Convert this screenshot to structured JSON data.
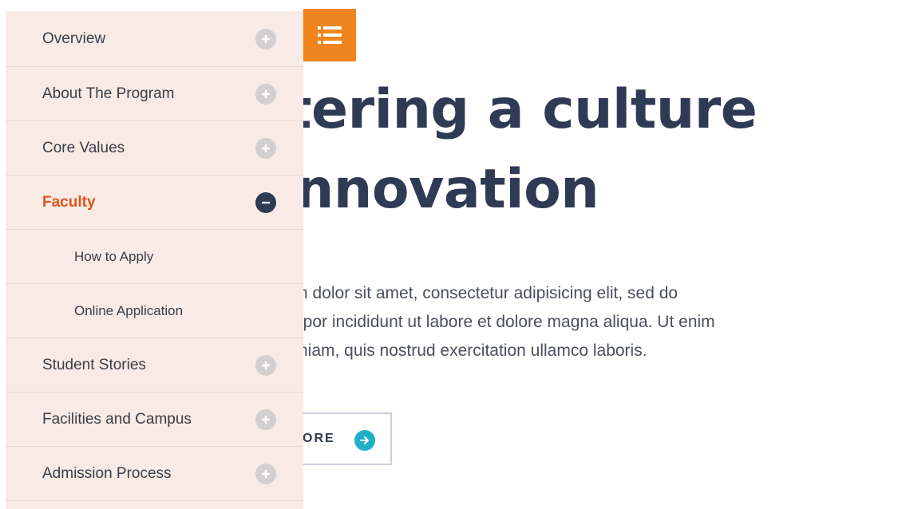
{
  "menu_toggle": {
    "icon": "list-icon",
    "color": "#f0851f"
  },
  "hero": {
    "title_line1": "tering a culture",
    "title_line2": "nnovation",
    "text_line1": "n dolor sit amet, consectetur adipisicing elit, sed do",
    "text_line2": "npor incididunt ut labore et dolore magna aliqua. Ut enim",
    "text_line3": "niam, quis nostrud exercitation ullamco laboris.",
    "button_label": "ORE",
    "button_icon": "arrow-right-icon"
  },
  "sidebar": {
    "items": [
      {
        "label": "Overview",
        "icon": "plus-circle-icon"
      },
      {
        "label": "About The Program",
        "icon": "plus-circle-icon"
      },
      {
        "label": "Core Values",
        "icon": "plus-circle-icon"
      },
      {
        "label": "Faculty",
        "icon": "minus-circle-icon",
        "active": true
      },
      {
        "label": "How to Apply",
        "sub": true
      },
      {
        "label": "Online Application",
        "sub": true
      },
      {
        "label": "Student Stories",
        "icon": "plus-circle-icon"
      },
      {
        "label": "Facilities and Campus",
        "icon": "plus-circle-icon"
      },
      {
        "label": "Admission Process",
        "icon": "plus-circle-icon"
      }
    ]
  },
  "colors": {
    "accent_orange": "#f0851f",
    "active_text": "#e0541c",
    "heading": "#2f3a55",
    "sidebar_bg": "#f8ebe5",
    "button_arrow": "#1fb0c8"
  }
}
